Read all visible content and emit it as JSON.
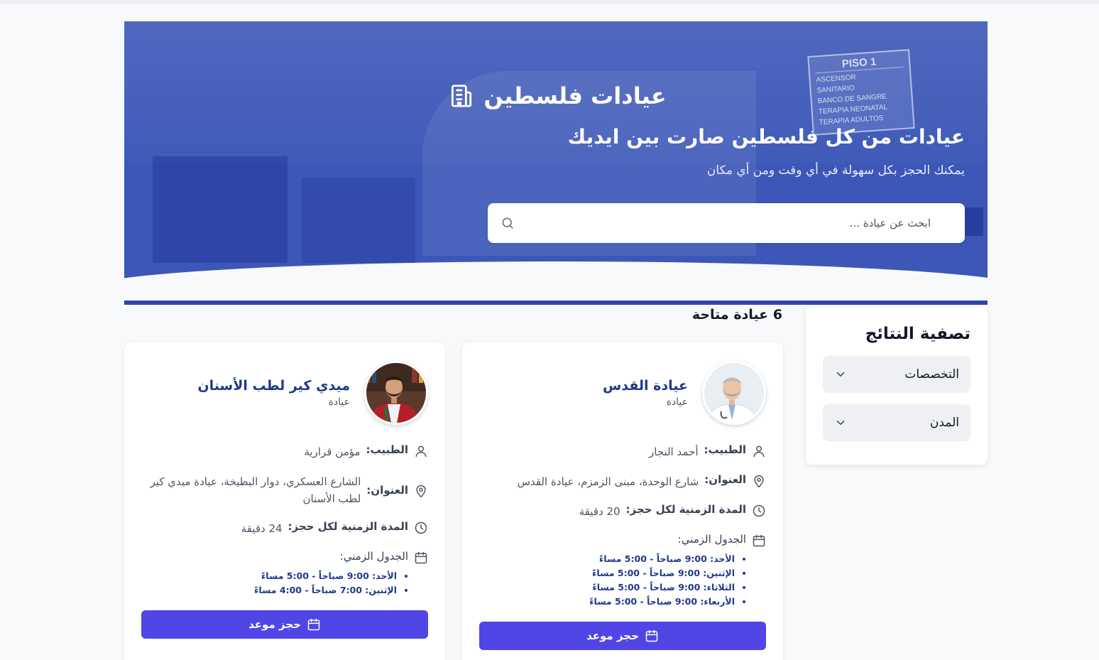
{
  "hero": {
    "title": "عيادات فلسطين",
    "subtitle": "عيادات من كل فلسطين صارت بين ايديك",
    "description": "يمكنك الحجز بكل سهولة في أي وقت ومن أي مكان",
    "search_placeholder": "ابحث عن عيادة ...",
    "sign": {
      "title": "PISO 1",
      "lines": [
        "ASCENSOR",
        "SANITARIO",
        "BANCO DE SANGRE",
        "TERAPIA NEONATAL",
        "TERAPIA ADULTOS"
      ]
    }
  },
  "filter": {
    "title": "تصفية النتائج",
    "dropdowns": [
      {
        "label": "التخصصات"
      },
      {
        "label": "المدن"
      }
    ]
  },
  "results": {
    "count_label": "6 عيادة متاحة"
  },
  "labels": {
    "doctor": "الطبيب:",
    "address": "العنوان:",
    "duration": "المدة الزمنية لكل حجز:",
    "schedule": "الجدول الزمني:",
    "book": "حجز موعد"
  },
  "clinics": [
    {
      "name": "عيادة القدس",
      "type": "عيادة",
      "doctor": "أحمد النجار",
      "address": "شارع الوحدة، مبنى الزمزم، عيادة القدس",
      "duration": "20 دقيقة",
      "schedule": [
        "الأحد: 9:00 صباحاً - 5:00 مساءً",
        "الإثنين: 9:00 صباحاً - 5:00 مساءً",
        "الثلاثاء: 9:00 صباحاً - 5:00 مساءً",
        "الأربعاء: 9:00 صباحاً - 5:00 مساءً"
      ]
    },
    {
      "name": "ميدي كير لطب الأسنان",
      "type": "عيادة",
      "doctor": "مؤمن قرارية",
      "address": "الشارع العسكري، دوار البطيخة، عيادة ميدي كير لطب الأسنان",
      "duration": "24 دقيقة",
      "schedule": [
        "الأحد: 9:00 صباحاً - 5:00 مساءً",
        "الإثنين: 7:00 صباحاً - 4:00 مساءً"
      ]
    }
  ],
  "colors": {
    "hero_blue": "#3c57b7",
    "accent_bar": "#2d46a6",
    "primary_button": "#4f46e5",
    "clinic_name": "#1e3a8a"
  }
}
